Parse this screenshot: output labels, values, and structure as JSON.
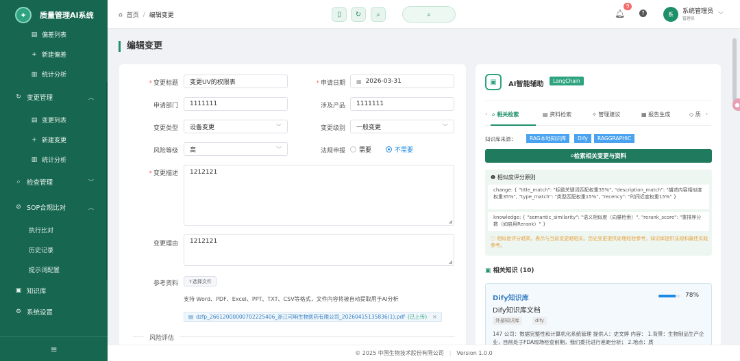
{
  "app": {
    "title": "质量管理AI系统"
  },
  "sidebar": {
    "items": [
      {
        "label": "偏差列表",
        "icon": "list-icon",
        "level": "sub"
      },
      {
        "label": "新建偏差",
        "icon": "plus-icon",
        "level": "sub"
      },
      {
        "label": "统计分析",
        "icon": "chart-icon",
        "level": "sub"
      },
      {
        "label": "变更管理",
        "icon": "refresh-icon",
        "level": "top",
        "expanded": true
      },
      {
        "label": "变更列表",
        "icon": "list-icon",
        "level": "sub"
      },
      {
        "label": "新建变更",
        "icon": "plus-icon",
        "level": "sub"
      },
      {
        "label": "统计分析",
        "icon": "chart-icon",
        "level": "sub"
      },
      {
        "label": "检查管理",
        "icon": "search-icon",
        "level": "top",
        "expanded": false
      },
      {
        "label": "SOP合规比对",
        "icon": "compare-icon",
        "level": "top",
        "expanded": true
      },
      {
        "label": "执行比对",
        "icon": "",
        "level": "sub2"
      },
      {
        "label": "历史记录",
        "icon": "",
        "level": "sub2"
      },
      {
        "label": "提示词配置",
        "icon": "",
        "level": "sub2"
      },
      {
        "label": "知识库",
        "icon": "book-icon",
        "level": "top"
      },
      {
        "label": "系统设置",
        "icon": "gear-icon",
        "level": "top"
      }
    ],
    "collapse_icon": "menu-icon"
  },
  "header": {
    "breadcrumb": {
      "home": "首页",
      "separator": "/",
      "current": "编辑变更"
    },
    "notifications": "9",
    "user": {
      "avatar": "系",
      "name": "系统管理员",
      "role": "管理员"
    }
  },
  "page": {
    "title": "编辑变更"
  },
  "form": {
    "title_label": "变更标题",
    "title_value": "变更UV的权限表",
    "date_label": "申请日期",
    "date_value": "2026-03-31",
    "dept_label": "申请部门",
    "dept_value": "1111111",
    "product_label": "涉及产品",
    "product_value": "1111111",
    "type_label": "变更类型",
    "type_value": "设备变更",
    "level_label": "变更级别",
    "level_value": "一般变更",
    "risk_label": "风险等级",
    "risk_value": "高",
    "report_label": "法规申报",
    "report_options": [
      "需要",
      "不需要"
    ],
    "report_selected": "不需要",
    "desc_label": "变更描述",
    "desc_value": "1212121",
    "reason_label": "变更理由",
    "reason_value": "1212121",
    "ref_label": "参考资料",
    "upload_label": "⇪选择文件",
    "upload_hint": "支持 Word、PDF、Excel、PPT、TXT、CSV等格式，文件内容将被自动提取用于AI分析",
    "file_name": "dzfp_26612000000702225406_浙江可明生物医药有限公司_20260415135836(1).pdf",
    "file_status": "(已上传)",
    "section_risk": "风险评估"
  },
  "ai": {
    "title": "AI智能辅助",
    "tag": "LangChain",
    "tabs": [
      "相关检索",
      "资料检索",
      "管理建议",
      "报告生成",
      "质"
    ],
    "active_tab": "相关检索",
    "kb_label": "知识库来源：",
    "kb_sources": [
      "RAG本地知识库",
      "Dify",
      "RAGGRAPHIC"
    ],
    "search_button": "检索相关变更与资料",
    "similarity": {
      "title": "相似度评分原则",
      "change": "change: { \"title_match\": \"标题关键词匹配权重35%\", \"description_match\": \"描述内容相似度权重35%\", \"type_match\": \"类型匹配权重15%\", \"recency\": \"时间近度权重15%\" }",
      "knowledge": "knowledge: { \"semantic_similarity\": \"语义相似度（向量检索）\", \"rerank_score\": \"重排序分数（如启用Rerank）\" }",
      "note": "相似度评分越高，表示与当前变更越相关。历史变更提供处理经验参考，知识库提供法规和最佳实践参考。"
    },
    "related_title": "相关知识 (10)",
    "result": {
      "source": "Dify知识库",
      "percent": "78%",
      "percent_value": 0.78,
      "name": "Dify知识库文档",
      "tags": [
        "外部知识库",
        "dify"
      ],
      "text": "147 公司：数据完整性和计算机化系统管理 提供人：史文婷 内容： 1.背景：生物制品生产企业，目前处于FDA现场检查前期，我们委托进行差距分析； 2.地点：质"
    }
  },
  "footer": {
    "copyright": "© 2025 中国生物技术股份有限公司",
    "version": "Version 1.0.0"
  },
  "colors": {
    "sidebar": "#17664f",
    "accent": "#1f8f6a",
    "link": "#1e88e5"
  }
}
